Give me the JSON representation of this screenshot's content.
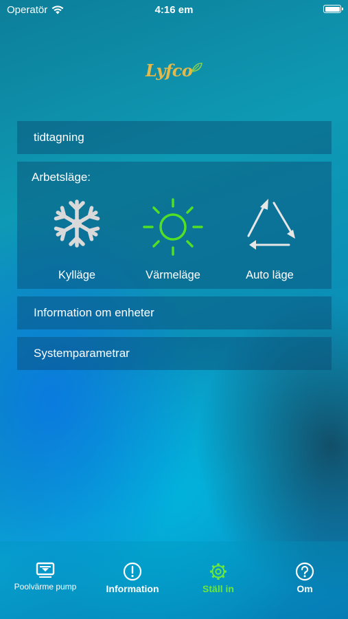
{
  "status_bar": {
    "carrier": "Operatör",
    "time": "4:16 em"
  },
  "logo": {
    "text": "Lyfco"
  },
  "rows": {
    "tidtagning": "tidtagning",
    "information": "Information om enheter",
    "system": "Systemparametrar"
  },
  "work_mode": {
    "title": "Arbetsläge:",
    "modes": [
      {
        "label": "Kylläge",
        "icon": "snowflake-icon"
      },
      {
        "label": "Värmeläge",
        "icon": "sun-icon"
      },
      {
        "label": "Auto läge",
        "icon": "triangle-arrows-icon"
      }
    ]
  },
  "tabbar": {
    "tabs": [
      {
        "label": "Poolvärme pump",
        "icon": "pool-pump-icon"
      },
      {
        "label": "Information",
        "icon": "exclamation-circle-icon"
      },
      {
        "label": "Ställ in",
        "icon": "gear-icon",
        "selected": true
      },
      {
        "label": "Om",
        "icon": "question-circle-icon"
      }
    ]
  },
  "colors": {
    "accent_green": "#6be83c",
    "logo_gold": "#e5b84a",
    "cool_icon": "#d9d9d9",
    "heat_icon": "#52e026"
  }
}
